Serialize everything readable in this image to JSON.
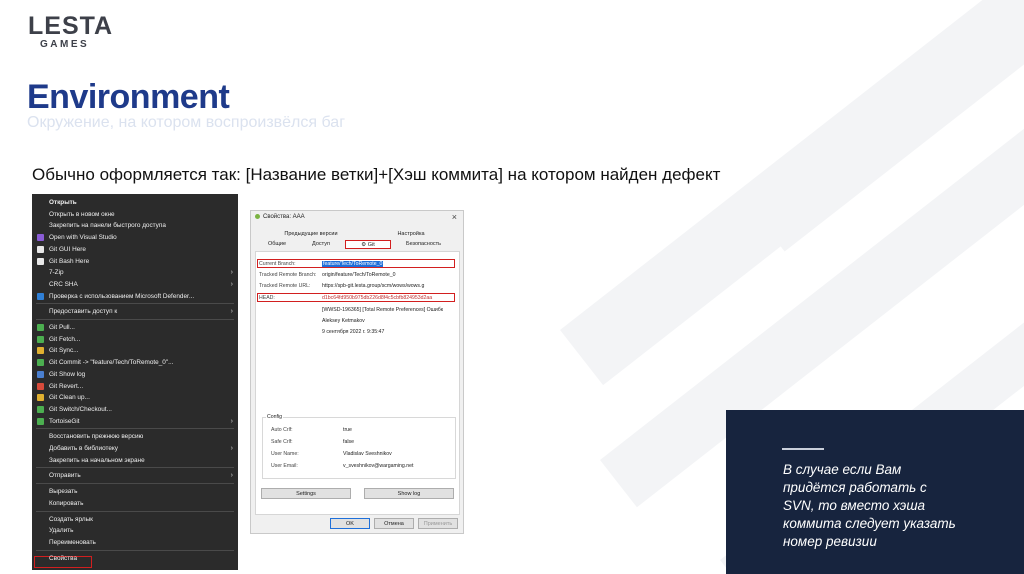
{
  "logo": {
    "line1": "LESTA",
    "line2": "GAMES"
  },
  "title": "Environment",
  "subtitle": "Окружение, на котором воспроизвёлся баг",
  "description": "Обычно оформляется так: [Название ветки]+[Хэш коммита] на котором найден дефект",
  "context_menu": {
    "items": [
      {
        "label": "Открыть",
        "bold": true
      },
      {
        "label": "Открыть в новом окне"
      },
      {
        "label": "Закрепить на панели быстрого доступа"
      },
      {
        "label": "Open with Visual Studio",
        "icon": "visual-studio-icon",
        "color": "#8a5cd6"
      },
      {
        "label": "Git GUI Here",
        "icon": "git-gui-icon",
        "color": "#e8e8e8"
      },
      {
        "label": "Git Bash Here",
        "icon": "git-bash-icon",
        "color": "#e8e8e8"
      },
      {
        "label": "7-Zip",
        "submenu": true
      },
      {
        "label": "CRC SHA",
        "submenu": true
      },
      {
        "label": "Проверка с использованием Microsoft Defender...",
        "icon": "defender-icon",
        "color": "#2f7fd6"
      },
      {
        "label": "Предоставить доступ к",
        "submenu": true,
        "sep_before": true
      },
      {
        "label": "Git Pull...",
        "icon": "git-pull-icon",
        "color": "#4caf50",
        "sep_before": true
      },
      {
        "label": "Git Fetch...",
        "icon": "git-fetch-icon",
        "color": "#4caf50"
      },
      {
        "label": "Git Sync...",
        "icon": "git-sync-icon",
        "color": "#e0b030"
      },
      {
        "label": "Git Commit -> \"feature/Tech/ToRemote_0\"...",
        "icon": "git-commit-icon",
        "color": "#4caf50"
      },
      {
        "label": "Git Show log",
        "icon": "git-log-icon",
        "color": "#4a7fd0"
      },
      {
        "label": "Git Revert...",
        "icon": "git-revert-icon",
        "color": "#d84b3b"
      },
      {
        "label": "Git Clean up...",
        "icon": "git-cleanup-icon",
        "color": "#e0b030"
      },
      {
        "label": "Git Switch/Checkout...",
        "icon": "git-switch-icon",
        "color": "#4caf50"
      },
      {
        "label": "TortoiseGit",
        "icon": "tortoisegit-icon",
        "color": "#4caf50",
        "submenu": true
      },
      {
        "label": "Восстановить прежнюю версию",
        "sep_before": true
      },
      {
        "label": "Добавить в библиотеку",
        "submenu": true
      },
      {
        "label": "Закрепить на начальном экране"
      },
      {
        "label": "Отправить",
        "submenu": true,
        "sep_before": true
      },
      {
        "label": "Вырезать",
        "sep_before": true
      },
      {
        "label": "Копировать"
      },
      {
        "label": "Создать ярлык",
        "sep_before": true
      },
      {
        "label": "Удалить"
      },
      {
        "label": "Переименовать"
      },
      {
        "label": "Свойства",
        "sep_before": true
      }
    ]
  },
  "dialog": {
    "title": "Свойства: AAA",
    "close": "×",
    "tabs_row1": [
      "Предыдущие версии",
      "Настройка"
    ],
    "tabs_row2": [
      "Общие",
      "Доступ",
      "Git",
      "Безопасность"
    ],
    "fields": [
      {
        "key": "Current Branch:",
        "value": "feature/Tech/ToRemote_0"
      },
      {
        "key": "Tracked Remote Branch:",
        "value": "origin/feature/Tech/ToRemote_0"
      },
      {
        "key": "Tracked Remote URL:",
        "value": "https://spb-git.lesta.group/scm/wows/wows.g"
      },
      {
        "key": "HEAD:",
        "value": "d1bc64fd950b975db226d8f4c5cbfb824953d2aa"
      }
    ],
    "commit_info": [
      "[WWSD-196365] [Total Remote Preferences] Ошибк",
      "Aleksey Ketmakov",
      "9 сентября 2022 г. 9:35:47"
    ],
    "config": {
      "legend": "Config",
      "rows": [
        {
          "key": "Auto Crlf:",
          "value": "true"
        },
        {
          "key": "Safe Crlf:",
          "value": "false"
        },
        {
          "key": "User Name:",
          "value": "Vladislav Sveshnikov"
        },
        {
          "key": "User Email:",
          "value": "v_sveshnikov@wargaming.net"
        }
      ]
    },
    "settings_btn": "Settings",
    "showlog_btn": "Show log",
    "ok_btn": "OK",
    "cancel_btn": "Отмена",
    "apply_btn": "Применить"
  },
  "callout": {
    "text": "В случае если Вам\nпридётся работать с\nSVN, то вместо хэша\nкоммита следует указать\nномер ревизии"
  },
  "colors": {
    "title": "#1e3a8a",
    "panel": "#17243e",
    "highlight": "#d21f1f"
  }
}
